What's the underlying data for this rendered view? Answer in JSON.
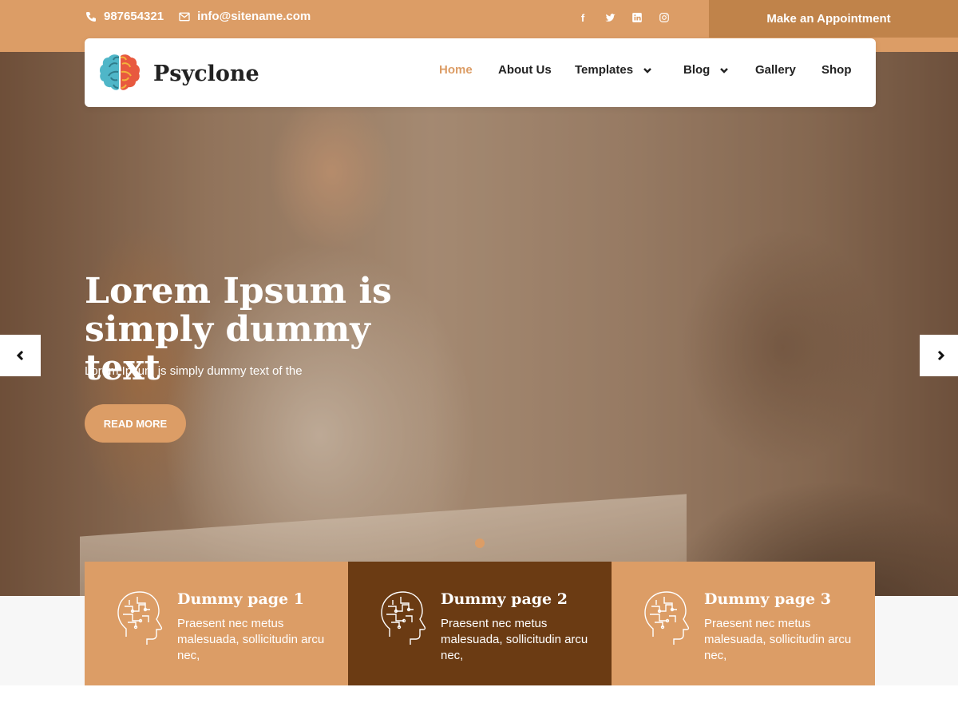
{
  "topbar": {
    "phone": "987654321",
    "email": "info@sitename.com",
    "social": [
      {
        "icon": "facebook-icon",
        "glyph": "f"
      },
      {
        "icon": "twitter-icon",
        "glyph": "t"
      },
      {
        "icon": "linkedin-icon",
        "glyph": "in"
      },
      {
        "icon": "instagram-icon",
        "glyph": "◎"
      }
    ],
    "appointment_label": "Make an Appointment"
  },
  "header": {
    "brand": "Psyclone",
    "menu": [
      {
        "label": "Home",
        "active": true,
        "dropdown": false
      },
      {
        "label": "About Us",
        "active": false,
        "dropdown": false
      },
      {
        "label": "Templates",
        "active": false,
        "dropdown": true
      },
      {
        "label": "Blog",
        "active": false,
        "dropdown": true
      },
      {
        "label": "Gallery",
        "active": false,
        "dropdown": false
      },
      {
        "label": "Shop",
        "active": false,
        "dropdown": false
      }
    ]
  },
  "hero": {
    "title": "Lorem Ipsum is simply dummy text",
    "subtitle": "Lorem Ipsum is simply dummy text of the",
    "button_label": "READ MORE"
  },
  "features": [
    {
      "title": "Dummy page 1",
      "text": "Praesent nec metus malesuada, sollicitudin arcu nec,",
      "style": "light"
    },
    {
      "title": "Dummy page 2",
      "text": "Praesent nec metus malesuada, sollicitudin arcu nec,",
      "style": "dark"
    },
    {
      "title": "Dummy page 3",
      "text": "Praesent nec metus malesuada, sollicitudin arcu nec,",
      "style": "light"
    }
  ],
  "colors": {
    "accent": "#dc9d66",
    "accent_dark": "#c0834a",
    "card_dark": "#6b3b13"
  }
}
